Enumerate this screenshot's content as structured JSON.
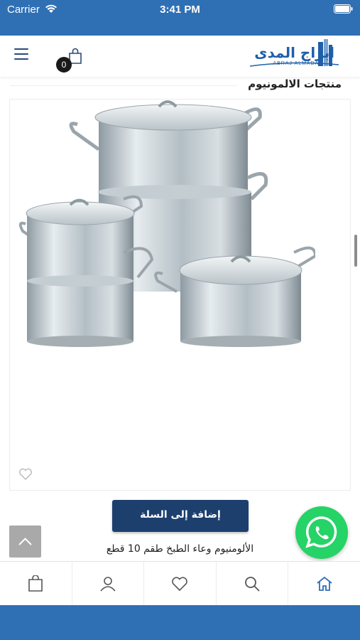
{
  "status_bar": {
    "carrier": "Carrier",
    "time": "3:41 PM"
  },
  "header": {
    "cart_count": "0",
    "logo_text": "ابراج المدى",
    "logo_subtitle": "ABRAJ ALMADAA"
  },
  "section": {
    "title": "منتجات الالمونيوم"
  },
  "product": {
    "name": "الألومنيوم وعاء الطبخ طقم 10 قطع",
    "add_to_cart_label": "إضافة إلى السلة"
  },
  "bottom_nav": [
    {
      "icon": "bag-icon"
    },
    {
      "icon": "user-icon"
    },
    {
      "icon": "heart-icon"
    },
    {
      "icon": "search-icon"
    },
    {
      "icon": "home-icon",
      "active": true
    }
  ],
  "colors": {
    "brand_blue": "#2f70b4",
    "button_navy": "#1c3f6e",
    "whatsapp_green": "#25d366"
  }
}
